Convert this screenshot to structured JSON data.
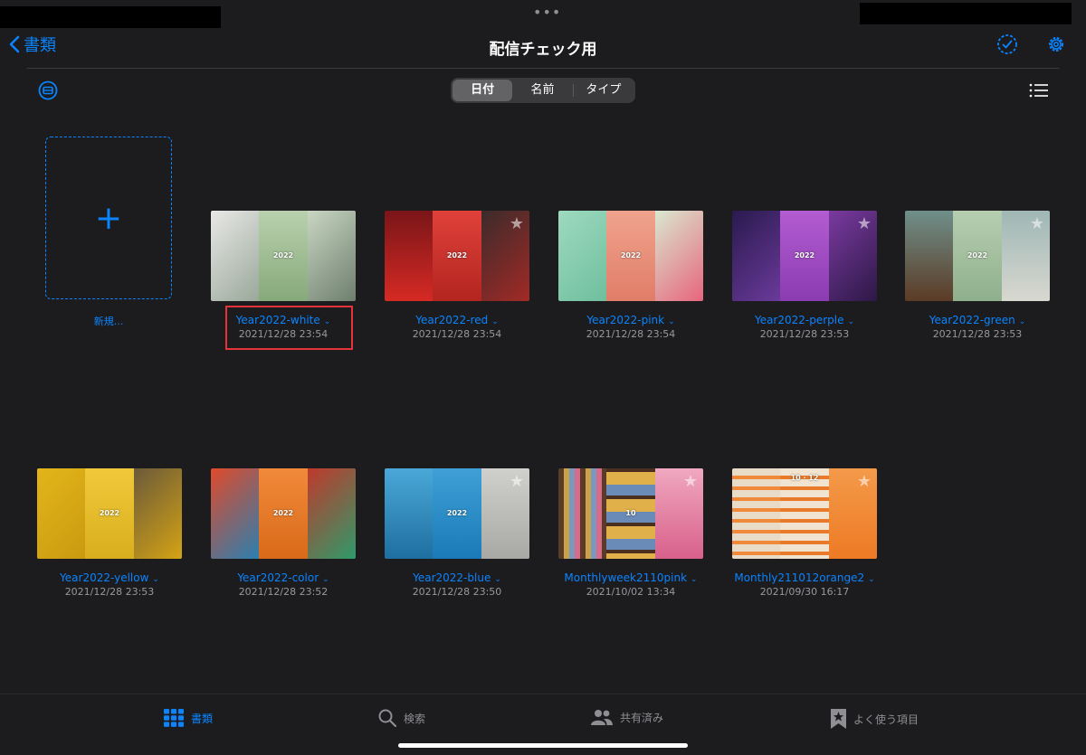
{
  "header": {
    "back_label": "書類",
    "title": "配信チェック用",
    "more_icon": "ellipsis-icon",
    "select_icon": "check-circle-icon",
    "settings_icon": "gear-icon"
  },
  "toolbar": {
    "sort_segments": [
      "日付",
      "名前",
      "タイプ"
    ],
    "active_sort": "日付",
    "view_toggle_icon": "list-view-icon",
    "scan_icon": "scan-icon"
  },
  "new_tile": {
    "label": "新規..."
  },
  "documents": [
    {
      "name": "Year2022-white",
      "date": "2021/12/28 23:54",
      "year": "2022"
    },
    {
      "name": "Year2022-red",
      "date": "2021/12/28 23:54",
      "year": "2022"
    },
    {
      "name": "Year2022-pink",
      "date": "2021/12/28 23:54",
      "year": "2022"
    },
    {
      "name": "Year2022-perple",
      "date": "2021/12/28 23:53",
      "year": "2022"
    },
    {
      "name": "Year2022-green",
      "date": "2021/12/28 23:53",
      "year": "2022"
    },
    {
      "name": "Year2022-yellow",
      "date": "2021/12/28 23:53",
      "year": "2022"
    },
    {
      "name": "Year2022-color",
      "date": "2021/12/28 23:52",
      "year": "2022"
    },
    {
      "name": "Year2022-blue",
      "date": "2021/12/28 23:50",
      "year": "2022"
    },
    {
      "name": "Monthlyweek2110pink",
      "date": "2021/10/02 13:34",
      "year": "10"
    },
    {
      "name": "Monthly211012orange2",
      "date": "2021/09/30 16:17",
      "year": "10 · 12"
    }
  ],
  "tabbar": {
    "items": [
      {
        "label": "書類",
        "icon": "grid-icon"
      },
      {
        "label": "検索",
        "icon": "search-icon"
      },
      {
        "label": "共有済み",
        "icon": "people-icon"
      },
      {
        "label": "よく使う項目",
        "icon": "bookmark-star-icon"
      }
    ]
  },
  "colors": {
    "accent": "#0a84ff",
    "background": "#1c1c1e",
    "highlight": "#e5323b"
  }
}
